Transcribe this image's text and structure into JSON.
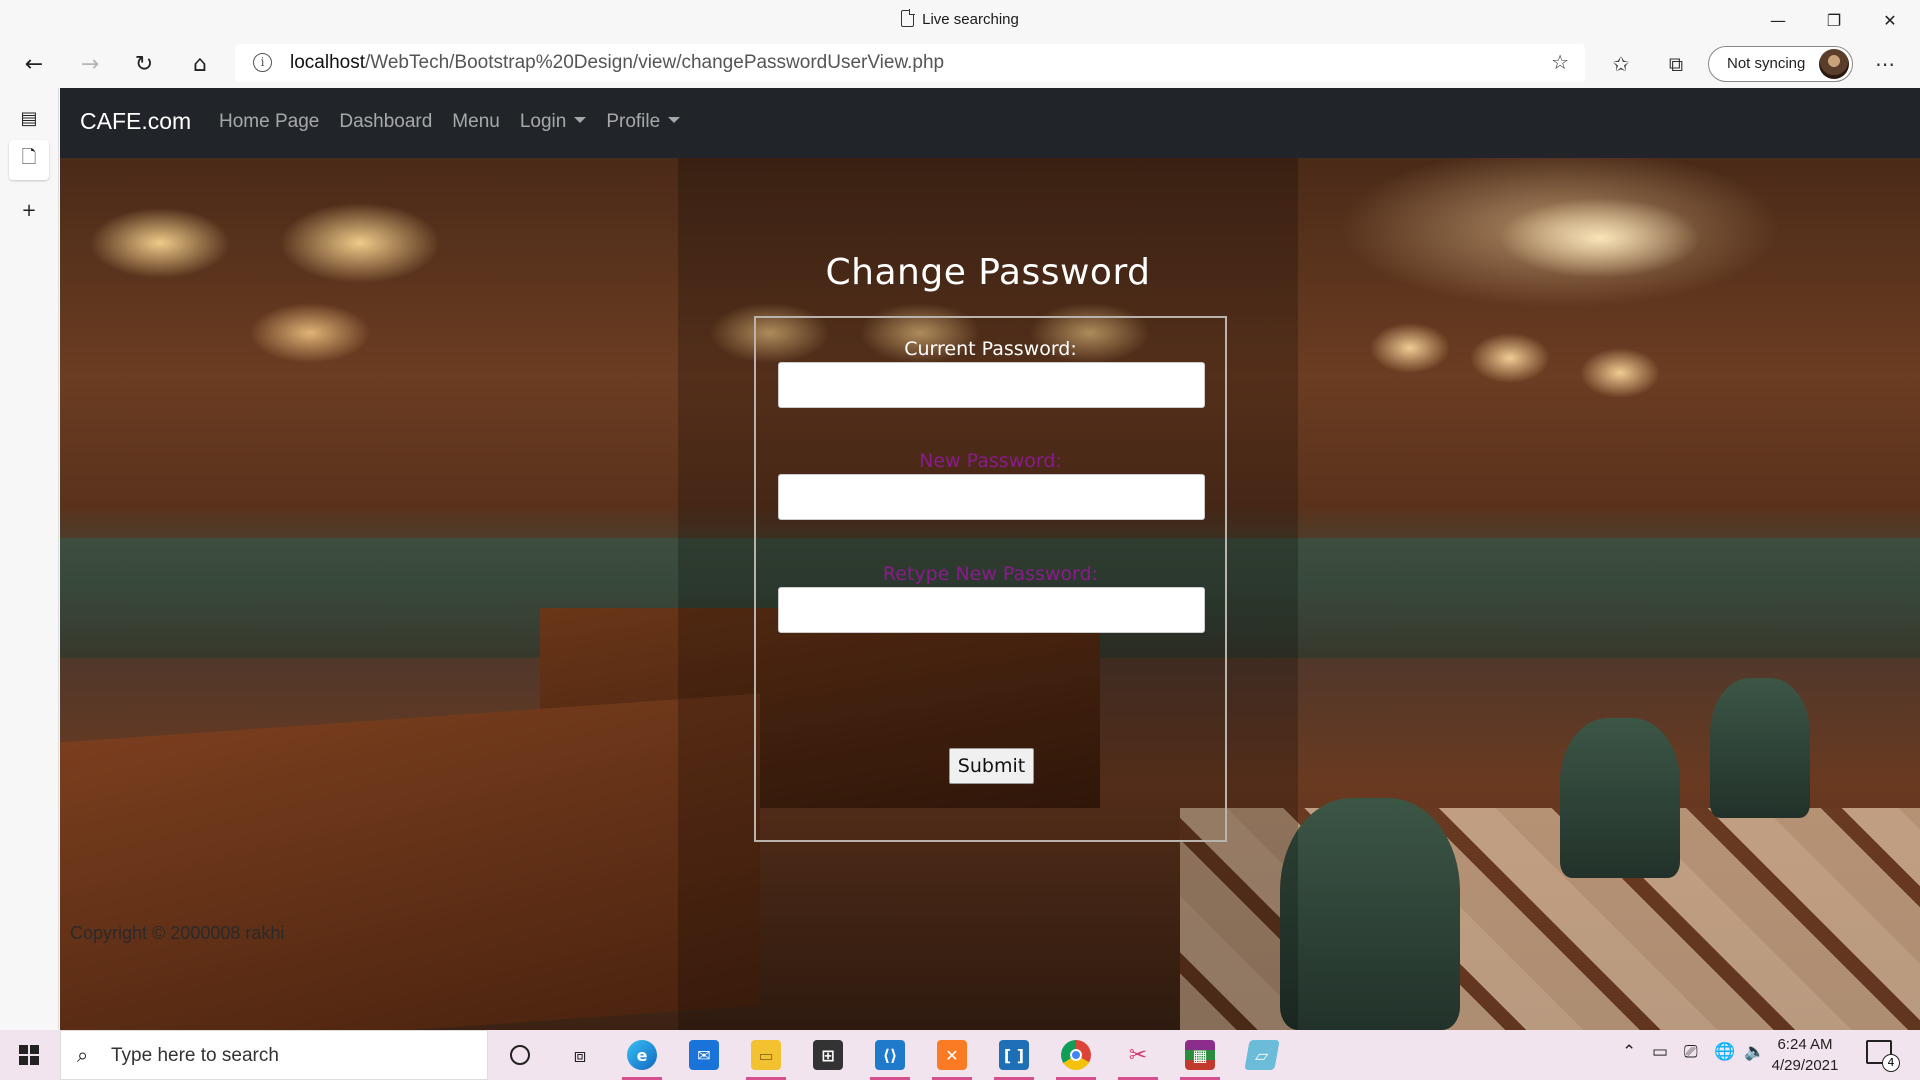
{
  "window": {
    "title": "Live searching",
    "controls": {
      "minimize": "—",
      "restore": "❐",
      "close": "✕"
    }
  },
  "browser": {
    "url_host": "localhost",
    "url_path": "/WebTech/Bootstrap%20Design/view/changePasswordUserView.php",
    "sync_label": "Not syncing",
    "nav_icons": [
      "back-icon",
      "forward-icon",
      "refresh-icon",
      "home-icon"
    ],
    "toolbar_icons": [
      "favorites-icon",
      "collections-icon",
      "more-icon"
    ]
  },
  "site": {
    "brand": "CAFE.com",
    "nav": [
      {
        "label": "Home Page",
        "dropdown": false
      },
      {
        "label": "Dashboard",
        "dropdown": false
      },
      {
        "label": "Menu",
        "dropdown": false
      },
      {
        "label": "Login",
        "dropdown": true
      },
      {
        "label": "Profile",
        "dropdown": true
      }
    ]
  },
  "form": {
    "heading": "Change Password",
    "fields": [
      {
        "label": "Current Password:",
        "value": "",
        "label_color": "#ffffff"
      },
      {
        "label": "New Password:",
        "value": "",
        "label_color": "#8b1a8b"
      },
      {
        "label": "Retype New Password:",
        "value": "",
        "label_color": "#8b1a8b"
      }
    ],
    "submit_label": "Submit"
  },
  "footer": {
    "copyright": "Copyright © 2000008 rakhi"
  },
  "taskbar": {
    "search_placeholder": "Type here to search",
    "apps": [
      "edge-icon",
      "mail-icon",
      "file-explorer-icon",
      "store-icon",
      "vscode-icon",
      "xampp-icon",
      "ide-icon",
      "chrome-icon",
      "snipping-tool-icon",
      "winrar-icon",
      "notepad-icon"
    ],
    "time": "6:24 AM",
    "date": "4/29/2021",
    "notification_count": "4"
  },
  "colors": {
    "navbar_bg": "#212529",
    "taskbar_bg": "#f2e4ee",
    "label_purple": "#8b1a8b"
  }
}
